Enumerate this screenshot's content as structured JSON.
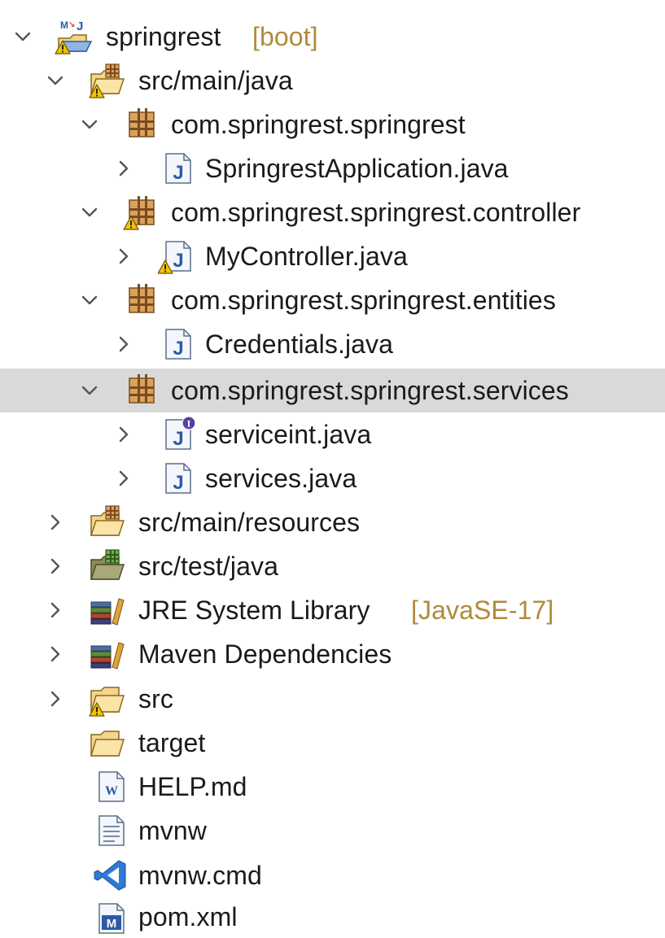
{
  "tree": {
    "project": {
      "name": "springrest",
      "decoration": "[boot]"
    },
    "src_main_java": "src/main/java",
    "pkg_main": "com.springrest.springrest",
    "file_app": "SpringrestApplication.java",
    "pkg_controller": "com.springrest.springrest.controller",
    "file_controller": "MyController.java",
    "pkg_entities": "com.springrest.springrest.entities",
    "file_credentials": "Credentials.java",
    "pkg_services": "com.springrest.springrest.services",
    "file_serviceint": "serviceint.java",
    "file_services": "services.java",
    "src_main_resources": "src/main/resources",
    "src_test_java": "src/test/java",
    "jre": {
      "name": "JRE System Library",
      "decoration": "[JavaSE-17]"
    },
    "maven": "Maven Dependencies",
    "src": "src",
    "target": "target",
    "help": "HELP.md",
    "mvnw": "mvnw",
    "mvnw_cmd": "mvnw.cmd",
    "pom": "pom.xml"
  },
  "icons": {
    "project": "maven-java-project-icon",
    "source_folder": "source-folder-icon",
    "package": "package-icon",
    "java_file": "java-class-file-icon",
    "java_interface": "java-interface-file-icon",
    "library": "library-icon",
    "folder": "folder-icon",
    "md_file": "markdown-file-icon",
    "text_file": "text-file-icon",
    "cmd_file": "vscode-cmd-file-icon",
    "xml_file": "maven-pom-file-icon",
    "warning": "warning-icon",
    "chevron_expanded": "chevron-down-icon",
    "chevron_collapsed": "chevron-right-icon"
  },
  "colors": {
    "selection": "#d9d9d9",
    "decoration_text": "#b08a3c",
    "warning": "#f2c200",
    "java_blue": "#2d5aa6",
    "package_brown": "#9a5b2c",
    "interface_purple": "#5a3ea0"
  }
}
